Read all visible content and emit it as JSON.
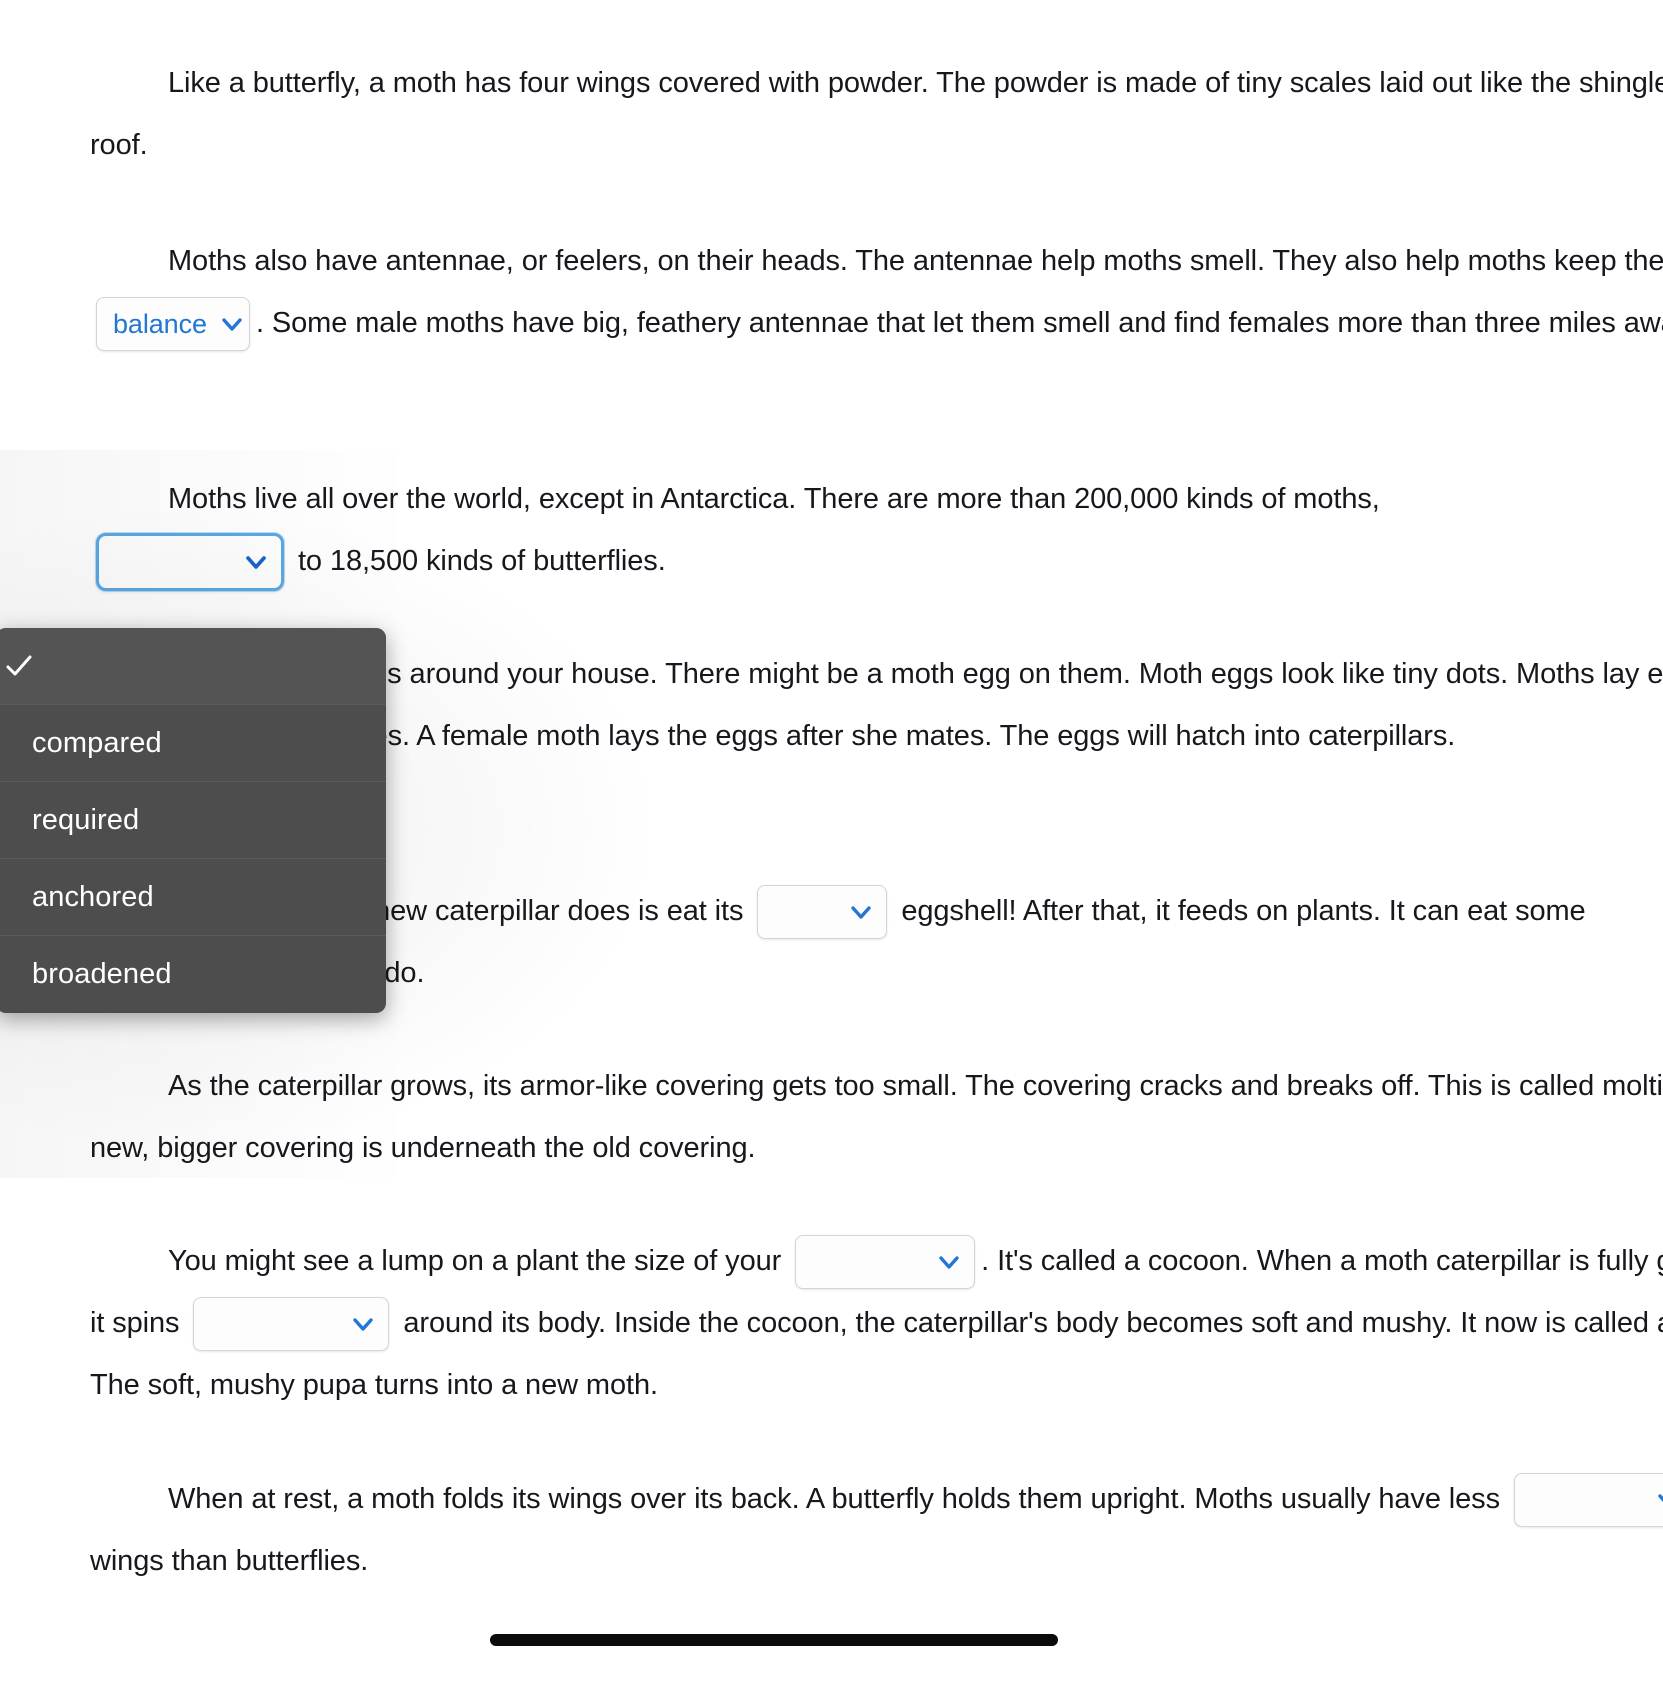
{
  "passage": {
    "paragraphs": [
      {
        "id": "p1",
        "segments": [
          {
            "type": "text",
            "value": "Like a butterfly, a moth has four wings covered with powder. The powder is made of tiny scales laid out like the shingles on a roof."
          }
        ]
      },
      {
        "id": "p2",
        "segments": [
          {
            "type": "text",
            "value": "Moths also have antennae, or feelers, on their heads. The antennae help moths smell. They also help moths keep their "
          },
          {
            "type": "select",
            "value": "balance"
          },
          {
            "type": "text",
            "value": ". Some male moths have big, feathery antennae that let them smell and find females more than three miles away!"
          }
        ]
      },
      {
        "id": "p3",
        "segments": [
          {
            "type": "text",
            "value": "Moths live all over the world, except in Antarctica. There are more than 200,000 kinds of moths, "
          },
          {
            "type": "select",
            "value": ""
          },
          {
            "type": "text",
            "value": " to 18,500 kinds of butterflies."
          }
        ]
      },
      {
        "id": "p4",
        "segments": [
          {
            "type": "text",
            "value": "Look at the leaves around your house. There might be a moth egg on them. Moth eggs look like tiny dots. Moths lay eggs on the undersides of leaves. A female moth lays the eggs after she mates. The eggs will hatch into caterpillars."
          }
        ]
      },
      {
        "id": "p5",
        "segments": [
          {
            "type": "text",
            "value": "The first thing a new caterpillar does is eat its "
          },
          {
            "type": "select",
            "value": ""
          },
          {
            "type": "text",
            "value": " eggshell! After that, it feeds on plants. It can eat some "
          },
          {
            "type": "select",
            "value": ""
          },
          {
            "type": "text",
            "value": " moths do."
          }
        ]
      },
      {
        "id": "p6",
        "segments": [
          {
            "type": "text",
            "value": "As the caterpillar grows, its armor-like covering gets too small. The covering cracks and breaks off. This is called molting. A new, bigger covering is underneath the old covering."
          }
        ]
      },
      {
        "id": "p7",
        "segments": [
          {
            "type": "text",
            "value": "You might see a lump on a plant the size of your "
          },
          {
            "type": "select",
            "value": ""
          },
          {
            "type": "text",
            "value": ". It's called a cocoon. When a moth caterpillar is fully grown, it spins "
          },
          {
            "type": "select",
            "value": ""
          },
          {
            "type": "text",
            "value": " around its body. Inside the cocoon, the caterpillar's body becomes soft and mushy. It now is called a pupa. The soft, mushy pupa turns into a new moth."
          }
        ]
      },
      {
        "id": "p8",
        "segments": [
          {
            "type": "text",
            "value": "When at rest, a moth folds its wings over its back. A butterfly holds them upright. Moths usually have less "
          },
          {
            "type": "select",
            "value": ""
          },
          {
            "type": "text",
            "value": " wings than butterflies."
          }
        ]
      }
    ],
    "p1_text": "Like a butterfly, a moth has four wings covered with powder. The powder is made of tiny scales laid out like the shingles on a roof.",
    "p2_before": "Moths also have antennae, or feelers, on their heads. The antennae help moths keep their",
    "p2_lead": "Moths also have antennae, or feelers, on their heads. The antennae help moths smell. They also help moths keep their",
    "p2_after": ". Some male moths have big, feathery antennae that let them smell and find females more than three miles away!",
    "p3_lead": "Moths live all over the world, except in Antarctica. There are more than 200,000 kinds of moths,",
    "p3_after": "to 18,500 kinds of butterflies.",
    "p4_text": "Look at the leaves around your house. There might be a moth egg on them. Moth eggs look like tiny dots. Moths lay eggs on the undersides of leaves. A female moth lays the eggs after she mates. The eggs will hatch into caterpillars.",
    "p5_lead": "The first thing a new caterpillar does is eat its",
    "p5_mid": "eggshell! After that, it feeds on plants. It can eat some",
    "p5_after": "moths do.",
    "p6_text": "As the caterpillar grows, its armor-like covering gets too small. The covering cracks and breaks off. This is called molting. A new, bigger covering is underneath the old covering.",
    "p7_lead": "You might see a lump on a plant the size of your",
    "p7_mid": ". It's called a cocoon. When a moth caterpillar is fully grown, it spins",
    "p7_after": "around its body. Inside the cocoon, the caterpillar's body becomes soft and mushy. It now is called a pupa. The soft, mushy pupa turns into a new moth.",
    "p8_lead": "When at rest, a moth folds its wings over its back. A butterfly holds them upright. Moths usually have less",
    "p8_after": "wings than butterflies."
  },
  "selects": {
    "balance": {
      "value": "balance",
      "name": "antennae-balance-select"
    },
    "blank_comparison": {
      "value": "",
      "name": "moth-count-comparison-select"
    },
    "blank_eggshell": {
      "value": "",
      "name": "eggshell-select"
    },
    "blank_eat_some": {
      "value": "",
      "name": "caterpillar-eat-select"
    },
    "blank_lump_size": {
      "value": "",
      "name": "cocoon-size-select"
    },
    "blank_spins": {
      "value": "",
      "name": "cocoon-spins-select"
    },
    "blank_wings": {
      "value": "",
      "name": "wings-select"
    }
  },
  "dropdown": {
    "open_for": "moth-count-comparison-select",
    "items": [
      {
        "label": "",
        "selected": true
      },
      {
        "label": "compared",
        "selected": false
      },
      {
        "label": "required",
        "selected": false
      },
      {
        "label": "anchored",
        "selected": false
      },
      {
        "label": "broadened",
        "selected": false
      }
    ]
  },
  "colors": {
    "link_blue": "#2176d6",
    "caret_blue": "#2176d6",
    "focus_ring": "#5aa9e6",
    "menu_bg": "#4d4d4d",
    "menu_text": "#ffffff",
    "text": "#16181d",
    "scrollbar": "#0b0b0b"
  },
  "scrollbar": {
    "name": "horizontal-scrollbar",
    "orientation": "horizontal"
  }
}
